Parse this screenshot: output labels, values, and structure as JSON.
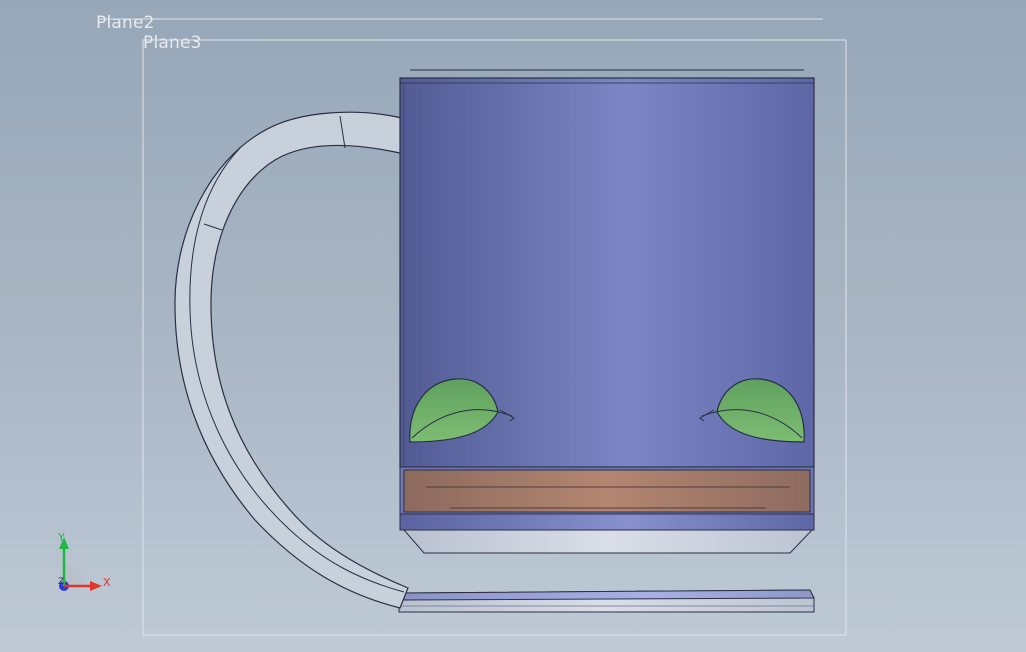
{
  "viewport": {
    "background_top": "#97a7b8",
    "background_bottom": "#bfcad6"
  },
  "planes": [
    {
      "label": "Plane2"
    },
    {
      "label": "Plane3"
    }
  ],
  "model": {
    "colors": {
      "body": "#6f78b6",
      "band": "#a47c6a",
      "handle": "#c7cfdb",
      "leaf": "#6aa86a",
      "outline": "#2a2f44"
    }
  },
  "triad": {
    "x_label": "X",
    "y_label": "Y",
    "z_label": "Z",
    "x_color": "#e0352a",
    "y_color": "#1fb845",
    "z_color": "#2a3bd6"
  }
}
